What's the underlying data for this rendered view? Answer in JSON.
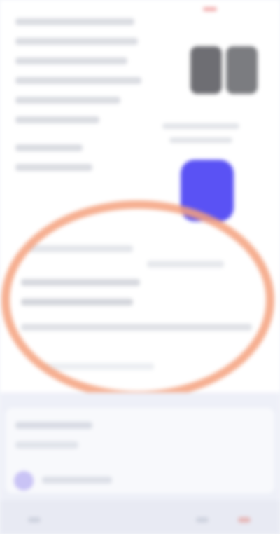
{
  "screen": {
    "description_visible_text": "",
    "accent_colors": {
      "primary_button": "#5a52f4",
      "annotation": "#f4a17e"
    }
  },
  "product": {
    "thumbnail_icon": "photo-thumbnail-icon",
    "primary_action_icon": "action-button-icon"
  },
  "annotation": {
    "shape": "circle",
    "color": "#f4a17e"
  },
  "bottom_sheet": {
    "avatar_icon": "avatar-icon"
  }
}
